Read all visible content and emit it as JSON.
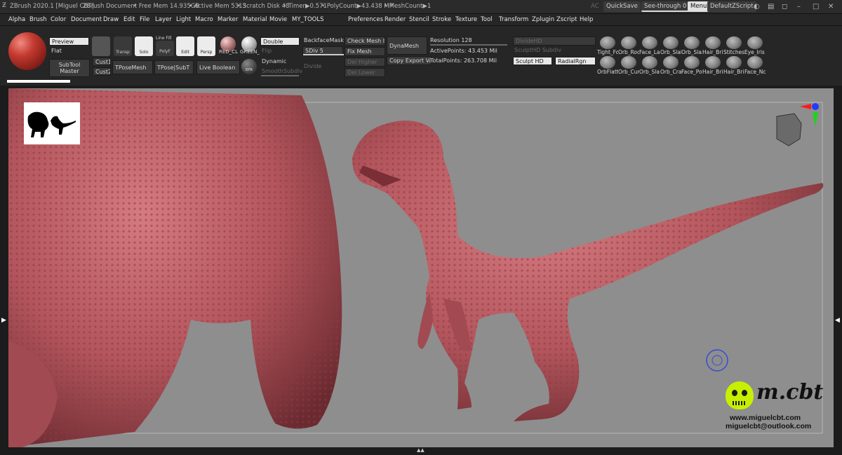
{
  "titlebar": {
    "app": "ZBrush 2020.1 [Miguel CBT]",
    "doc": "ZBrush Document",
    "free_mem": "• Free Mem 14.935GB",
    "active_mem": "• Active Mem 5313",
    "scratch": "• Scratch Disk 48",
    "timer": "• Timer▶0.571",
    "polycount": "• PolyCount▶43.438 MP",
    "meshcount": "• MeshCount▶1",
    "ac": "AC",
    "quicksave": "QuickSave",
    "seethrough": "See-through  0",
    "menus": "Menus",
    "defaultzscript": "DefaultZScript"
  },
  "menu": [
    "Alpha",
    "Brush",
    "Color",
    "Document",
    "Draw",
    "Edit",
    "File",
    "Layer",
    "Light",
    "Macro",
    "Marker",
    "MY_TOOLS",
    "Material",
    "Movie",
    "Preferences",
    "Render",
    "Stencil",
    "Stroke",
    "Texture",
    "Tool",
    "Transform",
    "Zplugin",
    "Zscript",
    "Help"
  ],
  "shelf": {
    "preview": "Preview",
    "flat": "Flat",
    "subtool_master": "SubTool\nMaster",
    "cust1": "Cust1",
    "cust2": "Cust2",
    "tposemesh": "TPoseMesh",
    "tposesubt": "TPose|SubT",
    "live_boolean": "Live Boolean",
    "transp": "Transp",
    "solo": "Solo",
    "line_fill": "Line Fill",
    "polyf": "PolyF",
    "edit": "Edit",
    "persp": "Persp",
    "red_cl": "RED_CL",
    "green": "GREEN_",
    "bpr": "BPR",
    "double": "Double",
    "flip": "Flip",
    "dynamic": "Dynamic",
    "smoothsubdiv": "SmoothSubdiv",
    "backfacemask": "BackfaceMask",
    "sdiv": "SDiv 5",
    "divide": "Divide",
    "check_mesh": "Check Mesh Inte",
    "fix_mesh": "Fix Mesh",
    "del_higher": "Del Higher",
    "del_lower": "Del Lower",
    "dynamesh": "DynaMesh",
    "copy_export": "Copy Export Values",
    "resolution": "Resolution 128",
    "active_points": "ActivePoints: 43.453 Mil",
    "total_points": "TotalPoints: 263.708 Mil",
    "dividehd": "DivideHD",
    "sculpthd_subdiv": "SculptHD Subdiv",
    "sculpt_hd": "Sculpt HD",
    "radialrgn": "RadialRgn",
    "brushes_row1": [
      "Tight_Fo",
      "Orb_Roc",
      "Face_La",
      "Orb_Slal",
      "Orb_Sla:",
      "Hair_Bri",
      "Stitches",
      "Eye_Iris"
    ],
    "brushes_row2": [
      "OrbFlatt",
      "Orb_Cur",
      "Orb_Sla:",
      "Orb_Cra",
      "Face_Po",
      "Hair_Bri",
      "Hair_Bri",
      "Face_Nc"
    ]
  },
  "watermark": {
    "brand": "m.cbt",
    "site": "www.miguelcbt.com",
    "email": "miguelcbt@outlook.com"
  },
  "colors": {
    "skin": "#b3555c",
    "canvas": "#8e8e8e",
    "ui_bg": "#262626"
  }
}
